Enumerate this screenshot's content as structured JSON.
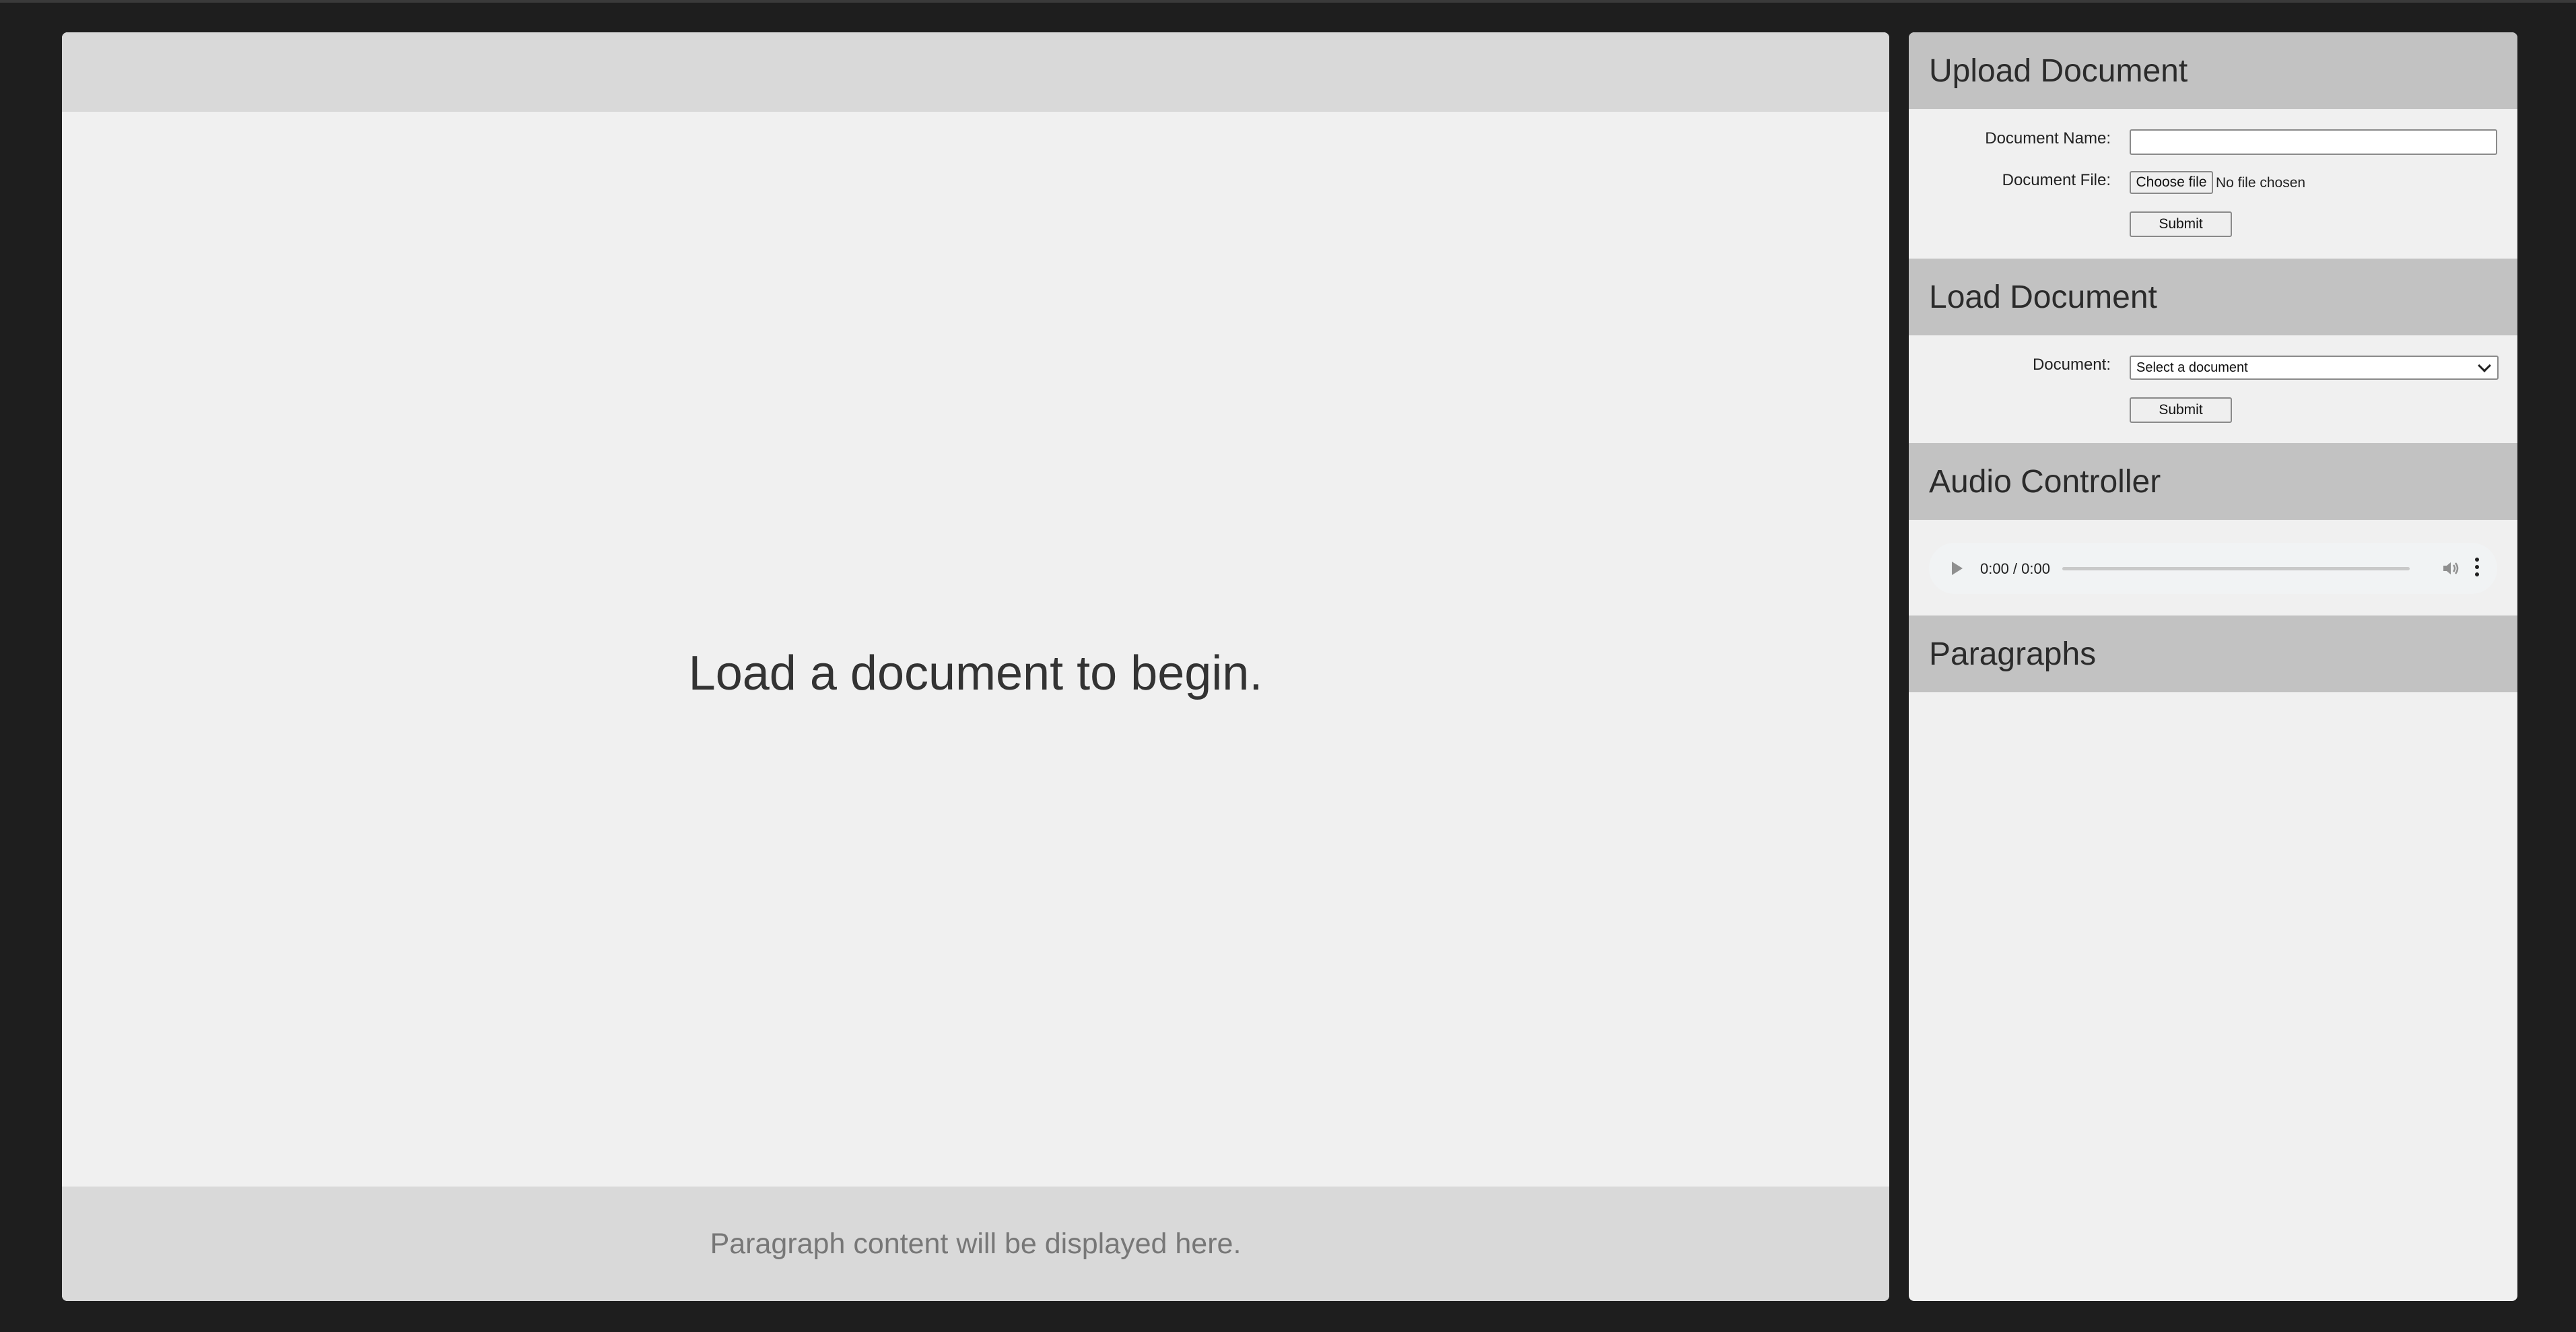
{
  "viewer": {
    "message": "Load a document to begin.",
    "footer_text": "Paragraph content will be displayed here."
  },
  "upload": {
    "title": "Upload Document",
    "name_label": "Document Name:",
    "name_value": "",
    "file_label": "Document File:",
    "choose_file_label": "Choose file",
    "file_status": "No file chosen",
    "submit_label": "Submit"
  },
  "load": {
    "title": "Load Document",
    "document_label": "Document:",
    "selected_option": "Select a document",
    "submit_label": "Submit"
  },
  "audio": {
    "title": "Audio Controller",
    "time_display": "0:00 / 0:00",
    "progress": 0,
    "icons": [
      "play-icon",
      "volume-icon",
      "more-options-icon"
    ]
  },
  "paragraphs": {
    "title": "Paragraphs",
    "items": []
  }
}
